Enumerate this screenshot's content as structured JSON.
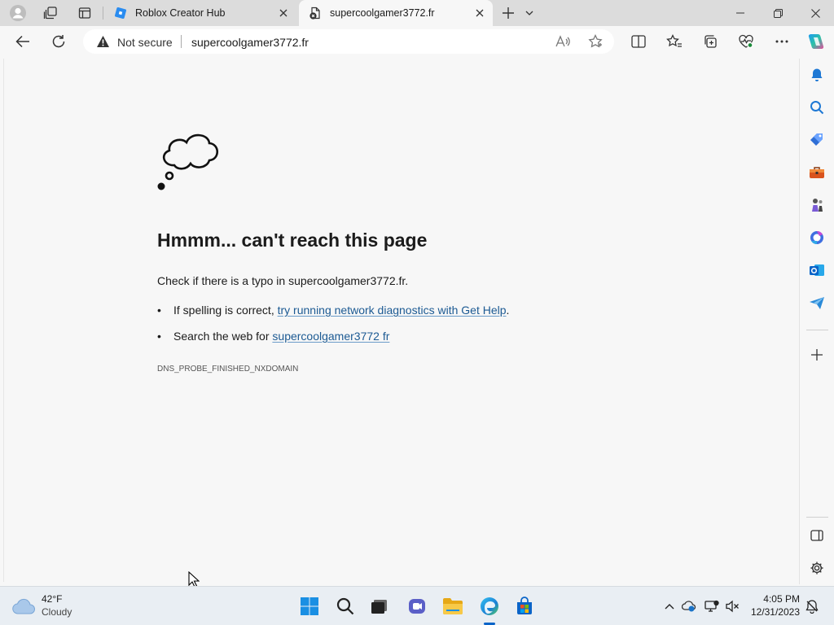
{
  "tabs": [
    {
      "title": "Roblox Creator Hub",
      "active": false
    },
    {
      "title": "supercoolgamer3772.fr",
      "active": true
    }
  ],
  "address_bar": {
    "security_label": "Not secure",
    "url": "supercoolgamer3772.fr"
  },
  "error_page": {
    "title": "Hmmm... can't reach this page",
    "hint": "Check if there is a typo in supercoolgamer3772.fr.",
    "bullet1_prefix": "If spelling is correct, ",
    "bullet1_link": "try running network diagnostics with Get Help",
    "bullet1_suffix": ".",
    "bullet2_prefix": "Search the web for ",
    "bullet2_link": "supercoolgamer3772 fr",
    "error_code": "DNS_PROBE_FINISHED_NXDOMAIN"
  },
  "taskbar": {
    "weather_temp": "42°F",
    "weather_condition": "Cloudy",
    "time": "4:05 PM",
    "date": "12/31/2023"
  },
  "colors": {
    "accent": "#0a64c8",
    "link": "#1c5a93",
    "page_bg": "#f7f7f7",
    "tabstrip_bg": "#dcdcdc"
  }
}
